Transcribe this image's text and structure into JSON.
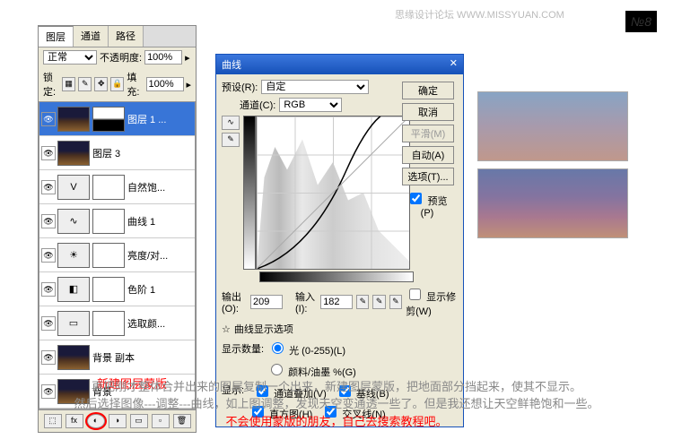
{
  "watermark": "思缘设计论坛   WWW.MISSYUAN.COM",
  "corner": "№8",
  "layersPanel": {
    "tabs": [
      "图层",
      "通道",
      "路径"
    ],
    "blendMode": "正常",
    "opacityLabel": "不透明度:",
    "opacity": "100%",
    "lockLabel": "锁定:",
    "fillLabel": "填充:",
    "fill": "100%",
    "layers": [
      {
        "name": "图层 1 ...",
        "type": "image",
        "mask": true,
        "selected": true
      },
      {
        "name": "图层 3",
        "type": "image"
      },
      {
        "name": "自然饱...",
        "type": "adj",
        "icon": "V"
      },
      {
        "name": "曲线 1",
        "type": "adj",
        "icon": "∿"
      },
      {
        "name": "亮度/对...",
        "type": "adj",
        "icon": "☀"
      },
      {
        "name": "色阶 1",
        "type": "adj",
        "icon": "◧"
      },
      {
        "name": "选取颜...",
        "type": "adj",
        "icon": "▭"
      },
      {
        "name": "背景 副本",
        "type": "image"
      },
      {
        "name": "背景",
        "type": "image"
      }
    ],
    "footerAnnotation": "新建图层蒙版"
  },
  "curvesDialog": {
    "title": "曲线",
    "presetLabel": "预设(R):",
    "preset": "自定",
    "channelLabel": "通道(C):",
    "channel": "RGB",
    "outputLabel": "输出(O):",
    "output": "209",
    "inputLabel": "输入(I):",
    "input": "182",
    "showClipLabel": "显示修剪(W)",
    "curveOptionsLabel": "曲线显示选项",
    "showAmountLabel": "显示数量:",
    "lightOpt": "光 (0-255)(L)",
    "pigmentOpt": "颜料/油墨 %(G)",
    "showLabel": "显示:",
    "chanOverlay": "通道叠加(V)",
    "baseline": "基线(B)",
    "histogram": "直方图(H)",
    "intersect": "交叉线(N)",
    "buttons": {
      "ok": "确定",
      "cancel": "取消",
      "smooth": "平滑(M)",
      "auto": "自动(A)",
      "options": "选项(T)...",
      "preview": "预览(P)"
    }
  },
  "caption": {
    "line1": "再把刚才整体合并出来的图层复制一个出来，新建图层蒙版，把地面部分挡起来，使其不显示。",
    "line2": "然后选择图像---调整---曲线，如上图调整，发现天空变通透一些了。但是我还想让天空鲜艳饱和一些。",
    "line3": "不会使用蒙版的朋友，自己去搜索教程吧。"
  }
}
